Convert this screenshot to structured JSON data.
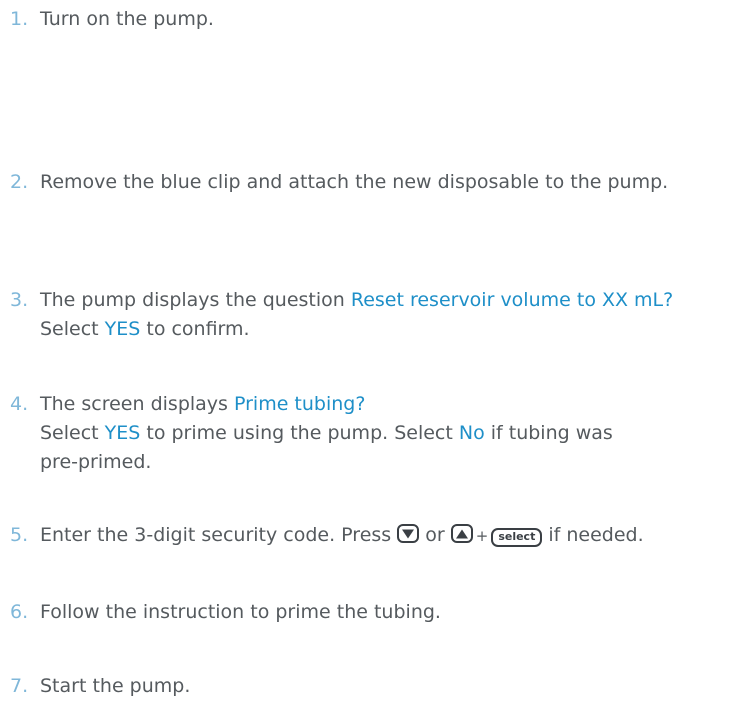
{
  "steps": [
    {
      "number": "1.",
      "line1": "Turn on the pump."
    },
    {
      "number": "2.",
      "line1": "Remove the blue clip and attach the new disposable to the pump."
    },
    {
      "number": "3.",
      "line1_text": "The pump displays the question ",
      "line1_highlight": "Reset reservoir volume to XX mL?",
      "line2_pre": "Select ",
      "line2_highlight": "YES",
      "line2_post": " to confirm."
    },
    {
      "number": "4.",
      "line1_text": "The screen displays ",
      "line1_highlight": "Prime tubing?",
      "line2_pre": "Select ",
      "line2_highlight1": "YES",
      "line2_mid": " to prime using the pump. Select ",
      "line2_highlight2": "No",
      "line2_post": " if tubing was",
      "line3": "pre-primed."
    },
    {
      "number": "5.",
      "text_pre": "Enter the 3-digit security code. Press ",
      "or": " or ",
      "plus": "+",
      "select_label": "select",
      "text_post": " if needed.",
      "down_icon": "down-arrow-button-icon",
      "up_icon": "up-arrow-button-icon"
    },
    {
      "number": "6.",
      "line1": "Follow the instruction to prime the tubing."
    },
    {
      "number": "7.",
      "line1": "Start the pump."
    }
  ],
  "colors": {
    "text": "#555a5e",
    "number": "#7fb7d9",
    "highlight": "#1e8fc8",
    "icon": "#3a3f44"
  }
}
